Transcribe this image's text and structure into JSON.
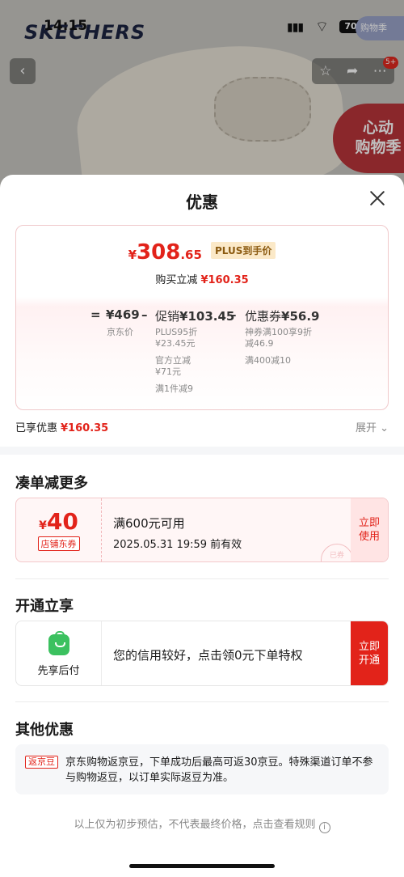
{
  "status_bar": {
    "time": "14:15",
    "battery": "70"
  },
  "product_bg": {
    "brand": "SKECHERS",
    "corner_promo": "购物季",
    "float_promo_line1": "心动",
    "float_promo_line2": "购物季",
    "message_badge": "5+"
  },
  "sheet": {
    "title": "优惠"
  },
  "price_calc": {
    "final_yen": "¥",
    "final_int": "308",
    "final_dec": ".65",
    "plus_tag": "PLUS到手价",
    "discount_label": "购买立减",
    "discount_amount": "¥160.35",
    "eq": "=",
    "minus": "–",
    "base_price": "¥469",
    "base_label": "京东价",
    "promo_label": "促销",
    "promo_amount": "¥103.45",
    "promo_sub1_line1": "PLUS95折",
    "promo_sub1_line2": "¥23.45元",
    "promo_sub2_line1": "官方立减",
    "promo_sub2_line2": "¥71元",
    "promo_sub3": "满1件减9",
    "coupon_label": "优惠券",
    "coupon_amount": "¥56.9",
    "coupon_sub1_line1": "神券满100享9折",
    "coupon_sub1_line2": "减46.9",
    "coupon_sub2": "满400减10"
  },
  "saved": {
    "label": "已享优惠",
    "amount": "¥160.35",
    "expand": "展开"
  },
  "more_deals": {
    "title": "凑单减更多",
    "coupon": {
      "yen": "¥",
      "amount": "40",
      "type": "店铺东券",
      "condition": "满600元可用",
      "validity": "2025.05.31 19:59 前有效",
      "button": "立即使用",
      "stamp": "已券"
    }
  },
  "open_enjoy": {
    "title": "开通立享",
    "label": "先享后付",
    "text": "您的信用较好，点击领0元下单特权",
    "button": "立即开通"
  },
  "other_deals": {
    "title": "其他优惠",
    "tag": "返京豆",
    "text": "京东购物返京豆，下单成功后最高可返30京豆。特殊渠道订单不参与购物返豆，以订单实际返豆为准。"
  },
  "footnote": "以上仅为初步预估，不代表最终价格，点击查看规则",
  "colors": {
    "accent_red": "#e2231a",
    "plus_gold": "#fbe9c8",
    "pay_green": "#3bc15f"
  }
}
